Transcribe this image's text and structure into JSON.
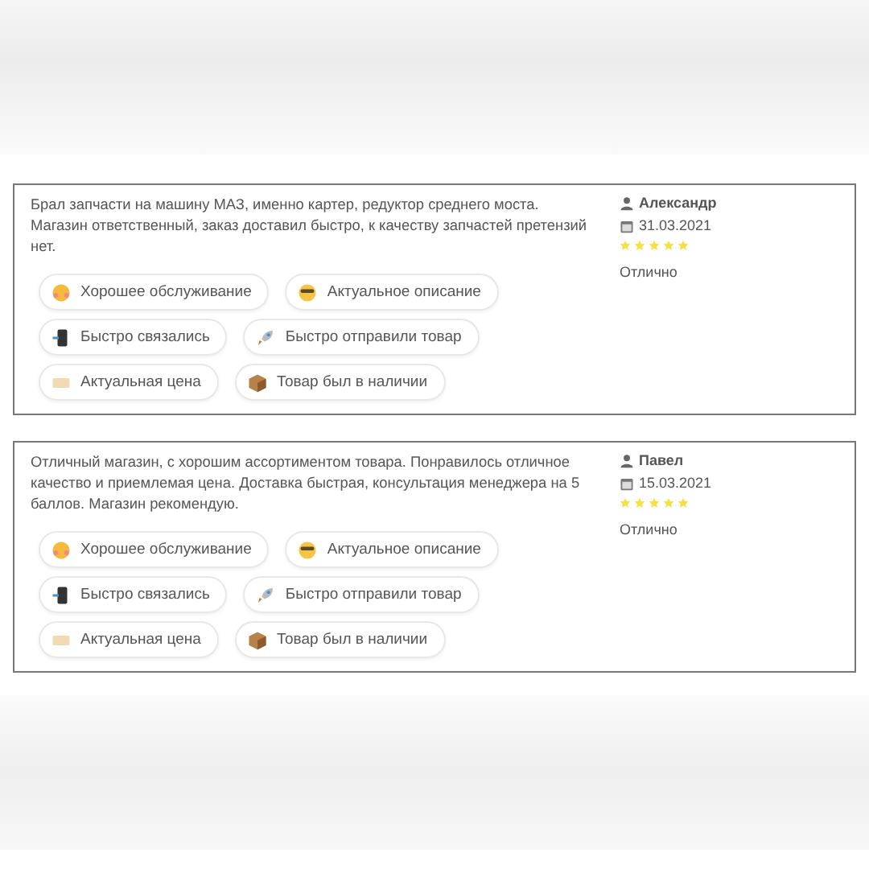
{
  "reviews": [
    {
      "text": "Брал запчасти на машину МАЗ, именно картер, редуктор среднего моста. Магазин ответственный, заказ доставил быстро, к качеству запчастей претензий нет.",
      "author": "Александр",
      "date": "31.03.2021",
      "stars": 5,
      "rating_label": "Отлично",
      "tags": [
        {
          "kind": "smile",
          "label": "Хорошее обслуживание"
        },
        {
          "kind": "cool",
          "label": "Актуальное описание"
        },
        {
          "kind": "phone",
          "label": "Быстро связались"
        },
        {
          "kind": "rocket",
          "label": "Быстро отправили товар"
        },
        {
          "kind": "price",
          "label": "Актуальная цена"
        },
        {
          "kind": "box",
          "label": "Товар был в наличии"
        }
      ]
    },
    {
      "text": "Отличный магазин, с хорошим ассортиментом товара. Понравилось отличное качество и приемлемая цена. Доставка быстрая, консультация менеджера на 5 баллов. Магазин рекомендую.",
      "author": "Павел",
      "date": "15.03.2021",
      "stars": 5,
      "rating_label": "Отлично",
      "tags": [
        {
          "kind": "smile",
          "label": "Хорошее обслуживание"
        },
        {
          "kind": "cool",
          "label": "Актуальное описание"
        },
        {
          "kind": "phone",
          "label": "Быстро связались"
        },
        {
          "kind": "rocket",
          "label": "Быстро отправили товар"
        },
        {
          "kind": "price",
          "label": "Актуальная цена"
        },
        {
          "kind": "box",
          "label": "Товар был в наличии"
        }
      ]
    }
  ]
}
